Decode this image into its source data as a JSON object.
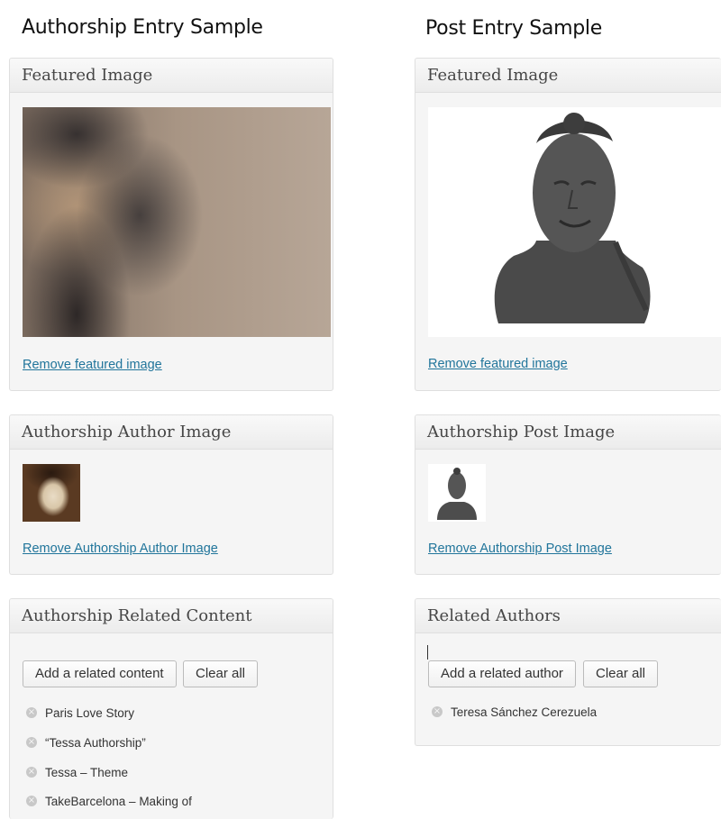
{
  "left_title": "Authorship Entry Sample",
  "right_title": "Post Entry Sample",
  "left": {
    "featured": {
      "title": "Featured Image",
      "image": "blurred-face-photo",
      "remove_label": "Remove featured image"
    },
    "author_image": {
      "title": "Authorship Author Image",
      "image": "author-portrait-thumbnail",
      "remove_label": "Remove Authorship Author Image"
    },
    "related": {
      "title": "Authorship Related Content",
      "add_label": "Add a related content",
      "clear_label": "Clear all",
      "items": [
        "Paris Love Story",
        "“Tessa Authorship”",
        "Tessa – Theme",
        "TakeBarcelona – Making of"
      ]
    }
  },
  "right": {
    "featured": {
      "title": "Featured Image",
      "image": "sculpture-bust-photo",
      "remove_label": "Remove featured image"
    },
    "post_image": {
      "title": "Authorship Post Image",
      "image": "sculpture-thumbnail",
      "remove_label": "Remove Authorship Post Image"
    },
    "related": {
      "title": "Related Authors",
      "add_label": "Add a related author",
      "clear_label": "Clear all",
      "items": [
        "Teresa Sánchez Cerezuela"
      ]
    }
  }
}
